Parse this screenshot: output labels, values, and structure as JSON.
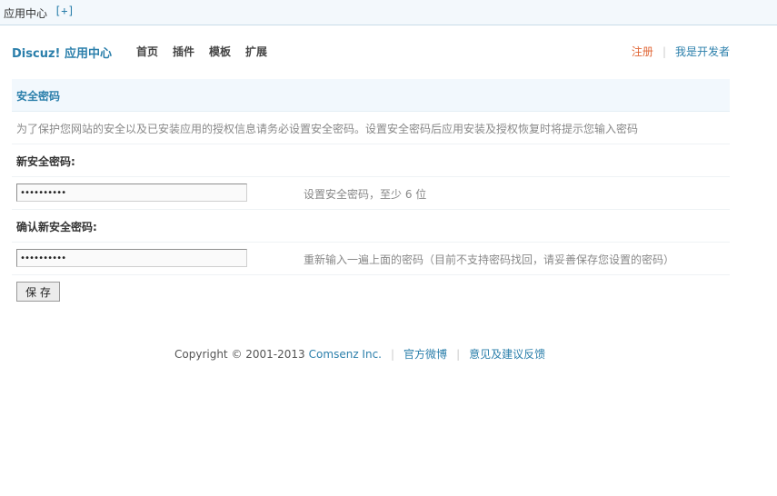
{
  "topbar": {
    "title": "应用中心",
    "add_label": "[+]"
  },
  "header": {
    "brand": "Discuz! 应用中心",
    "nav": [
      {
        "label": "首页"
      },
      {
        "label": "插件"
      },
      {
        "label": "模板"
      },
      {
        "label": "扩展"
      }
    ],
    "register_label": "注册",
    "separator": "|",
    "developer_label": "我是开发者",
    "register_color": "#e06636",
    "link_color": "#2b7fab"
  },
  "form": {
    "section_title": "安全密码",
    "description": "为了保护您网站的安全以及已安装应用的授权信息请务必设置安全密码。设置安全密码后应用安装及授权恢复时将提示您输入密码",
    "new_password": {
      "label": "新安全密码:",
      "value": "••••••••••",
      "hint": "设置安全密码，至少 6 位"
    },
    "confirm_password": {
      "label": "确认新安全密码:",
      "value": "••••••••••",
      "hint": "重新输入一遍上面的密码（目前不支持密码找回，请妥善保存您设置的密码）"
    },
    "save_label": "保 存"
  },
  "footer": {
    "copyright": "Copyright © 2001-2013",
    "company": "Comsenz Inc.",
    "separator": "|",
    "weibo_label": "官方微博",
    "feedback_label": "意见及建议反馈"
  }
}
